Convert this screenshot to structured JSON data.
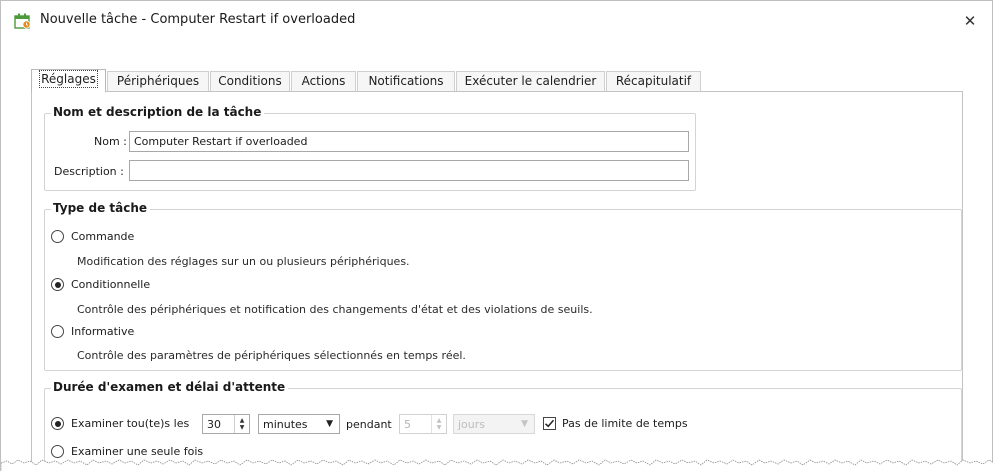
{
  "window": {
    "title": "Nouvelle tâche - Computer Restart if overloaded",
    "close_symbol": "✕"
  },
  "tabs": [
    {
      "label": "Réglages",
      "active": true
    },
    {
      "label": "Périphériques",
      "active": false
    },
    {
      "label": "Conditions",
      "active": false
    },
    {
      "label": "Actions",
      "active": false
    },
    {
      "label": "Notifications",
      "active": false
    },
    {
      "label": "Exécuter le calendrier",
      "active": false
    },
    {
      "label": "Récapitulatif",
      "active": false
    }
  ],
  "name_group": {
    "title": "Nom et description de la tâche",
    "name_label": "Nom :",
    "name_value": "Computer Restart if overloaded",
    "description_label": "Description :",
    "description_value": ""
  },
  "type_group": {
    "title": "Type de tâche",
    "options": [
      {
        "label": "Commande",
        "checked": false,
        "description": "Modification des réglages sur un ou plusieurs périphériques."
      },
      {
        "label": "Conditionnelle",
        "checked": true,
        "description": "Contrôle des périphériques et notification des changements d'état et des violations de seuils."
      },
      {
        "label": "Informative",
        "checked": false,
        "description": "Contrôle des paramètres de périphériques sélectionnés en temps réel."
      }
    ]
  },
  "duration_group": {
    "title": "Durée d'examen et délai d'attente",
    "examine_every_label": "Examiner tou(te)s les",
    "interval_value": "30",
    "interval_unit": "minutes",
    "during_label": "pendant",
    "duration_value": "5",
    "duration_unit": "jours",
    "no_limit_label": "Pas de limite de temps",
    "no_limit_checked": true,
    "examine_once_label": "Examiner une seule fois"
  },
  "colors": {
    "border": "#c3c3c3",
    "group_border": "#d4d4d4",
    "disabled_text": "#b4b4b4",
    "icon_green": "#4c9a3c"
  }
}
